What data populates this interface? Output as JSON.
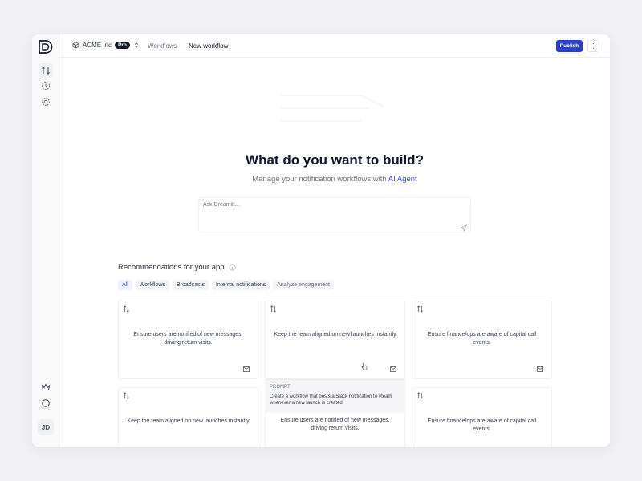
{
  "sidebar": {
    "avatar_initials": "JD",
    "icons": [
      "workflow-icon",
      "activity-icon",
      "settings-icon",
      "crown-icon",
      "circle-icon"
    ]
  },
  "topbar": {
    "org_name": "ACME Inc",
    "plan_badge": "Pro",
    "breadcrumb_1": "Workflows",
    "breadcrumb_2": "New workflow",
    "publish_label": "Publish",
    "more_label": "⋮"
  },
  "hero": {
    "title": "What do you want to build?",
    "subtitle_prefix": "Manage your notification workflows with ",
    "subtitle_link": "AI Agent",
    "input_placeholder": "Ask Dreamilt..."
  },
  "recommendations": {
    "title": "Recommendations for your app",
    "filters": [
      "All",
      "Workflows",
      "Broadcasts",
      "Internal notifications",
      "Analyze engagement"
    ],
    "cards": [
      "Ensure users are notified of new messages, driving return visits.",
      "Keep the team aligned on new launches instantly",
      "Ensure finance/ops are aware of capital call events.",
      "Keep the team aligned on new launches instantly",
      "Ensure users are notified of new messages, driving return visits.",
      "Ensure finance/ops are aware of capital call events."
    ],
    "prompt_label": "PROMPT",
    "prompt_text": "Create a workflow that posts a Slack notification to #team whenever a new launch is created"
  },
  "colors": {
    "accent": "#2b3fcc",
    "link": "#3b4bd9",
    "background": "#f1f1f5"
  }
}
